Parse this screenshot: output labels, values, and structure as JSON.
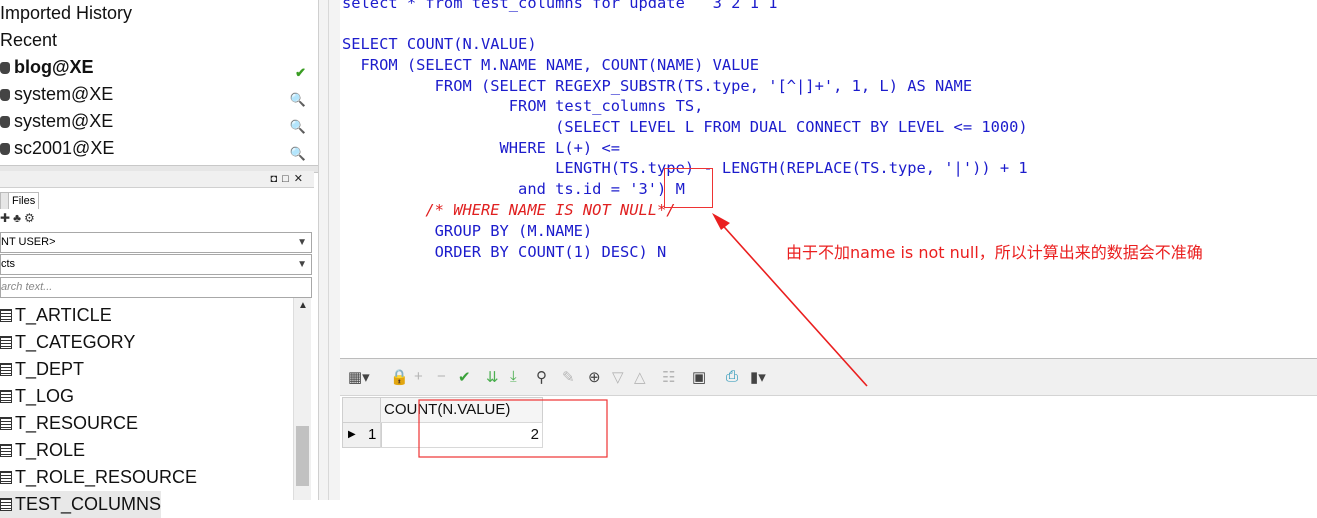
{
  "navigator": {
    "sections": {
      "imported_history": "Imported History",
      "recent": "Recent"
    },
    "connections": [
      {
        "label": "blog@XE",
        "active": true
      },
      {
        "label": "system@XE",
        "active": false
      },
      {
        "label": "system@XE",
        "active": false
      },
      {
        "label": "sc2001@XE",
        "active": false
      }
    ]
  },
  "object_browser": {
    "tab_files": "Files",
    "user_select": "NT USER>",
    "type_select": "cts",
    "search_placeholder": "arch text...",
    "tables": [
      "T_ARTICLE",
      "T_CATEGORY",
      "T_DEPT",
      "T_LOG",
      "T_RESOURCE",
      "T_ROLE",
      "T_ROLE_RESOURCE",
      "TEST_COLUMNS"
    ]
  },
  "editor": {
    "lines": [
      {
        "text": "select * from test_columns for update   3 2 1 1",
        "style": "kw"
      },
      {
        "text": "",
        "style": "kw"
      },
      {
        "text": "SELECT COUNT(N.VALUE)",
        "style": "kw"
      },
      {
        "text": "  FROM (SELECT M.NAME NAME, COUNT(NAME) VALUE",
        "style": "kw"
      },
      {
        "text": "          FROM (SELECT REGEXP_SUBSTR(TS.type, '[^|]+', 1, L) AS NAME",
        "style": "kw"
      },
      {
        "text": "                  FROM test_columns TS,",
        "style": "kw"
      },
      {
        "text": "                       (SELECT LEVEL L FROM DUAL CONNECT BY LEVEL <= 1000)",
        "style": "kw"
      },
      {
        "text": "                 WHERE L(+) <=",
        "style": "kw"
      },
      {
        "text": "                       LENGTH(TS.type) - LENGTH(REPLACE(TS.type, '|')) + 1",
        "style": "kw"
      },
      {
        "text": "                   and ts.id = '3') M",
        "style": "kw"
      },
      {
        "text": "         /* WHERE NAME IS NOT NULL*/",
        "style": "cmt"
      },
      {
        "text": "          GROUP BY (M.NAME)",
        "style": "kw"
      },
      {
        "text": "          ORDER BY COUNT(1) DESC) N",
        "style": "kw"
      }
    ],
    "annotation": "由于不加name is not null，所以计算出来的数据会不准确",
    "annotation_color": "#ea1f1f",
    "keyword_color": "#1c1ccc"
  },
  "result": {
    "columns": [
      "COUNT(N.VALUE)"
    ],
    "rows": [
      {
        "index": "1",
        "values": [
          "2"
        ]
      }
    ]
  }
}
